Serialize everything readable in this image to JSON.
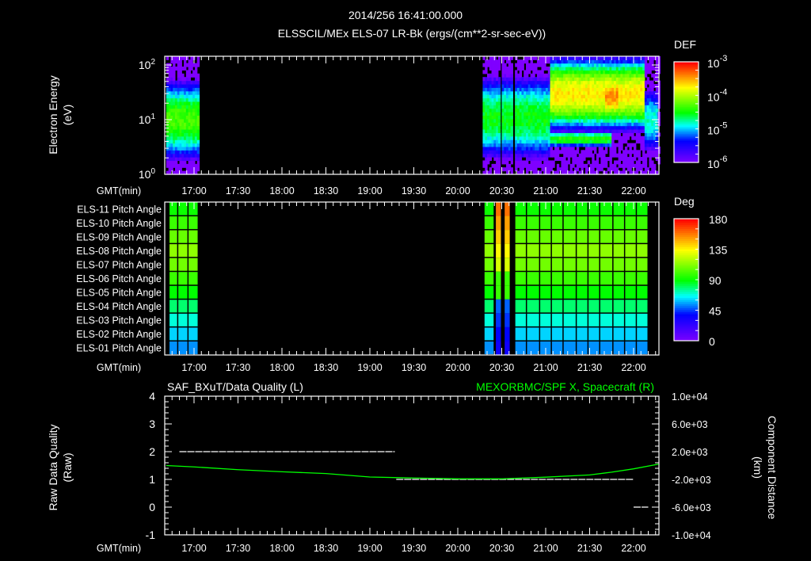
{
  "header": {
    "datetime": "2014/256 16:41:00.000",
    "subtitle": "ELSSCIL/MEx ELS-07 LR-Bk  (ergs/(cm**2-sr-sec-eV))"
  },
  "time_axis": {
    "label": "GMT(min)",
    "start_min": 1001,
    "end_min": 1337,
    "tick_labels": [
      "17:00",
      "17:30",
      "18:00",
      "18:30",
      "19:00",
      "19:30",
      "20:00",
      "20:30",
      "21:00",
      "21:30",
      "22:00"
    ]
  },
  "chart_data": [
    {
      "type": "heatmap",
      "title": "ELSSCIL/MEx ELS-07 LR-Bk  (ergs/(cm**2-sr-sec-eV))",
      "ylabel_line1": "Electron Energy",
      "ylabel_line2": "(eV)",
      "yscale": "log",
      "ylim": [
        1,
        145
      ],
      "y_ticks": [
        {
          "base": "10",
          "exp": "2",
          "value": 100
        },
        {
          "base": "10",
          "exp": "1",
          "value": 10
        },
        {
          "base": "10",
          "exp": "0",
          "value": 1
        }
      ],
      "colorbar": {
        "label": "DEF",
        "scale": "log",
        "range_log10": [
          -6,
          -3
        ],
        "ticks": [
          {
            "base": "10",
            "exp": "-3",
            "value": -3
          },
          {
            "base": "10",
            "exp": "-4",
            "value": -4
          },
          {
            "base": "10",
            "exp": "-5",
            "value": -5
          },
          {
            "base": "10",
            "exp": "-6",
            "value": -6
          }
        ]
      },
      "data_intervals_min": [
        [
          1001,
          1023
        ],
        [
          1217,
          1225
        ],
        [
          1226,
          1229
        ],
        [
          1230,
          1237
        ],
        [
          1239,
          1337
        ]
      ],
      "components": [
        {
          "t": [
            1001,
            1023
          ],
          "center_eV": 10,
          "peak_log10_def": -4.3,
          "width_dec": 0.55
        },
        {
          "t": [
            1217,
            1263
          ],
          "center_eV": 11,
          "peak_log10_def": -4.5,
          "width_dec": 0.6
        },
        {
          "t": [
            1263,
            1328
          ],
          "center_eV": 30,
          "peak_log10_def": -3.7,
          "width_dec": 0.45
        },
        {
          "t": [
            1300,
            1310
          ],
          "center_eV": 27,
          "peak_log10_def": -3.4,
          "width_dec": 0.3
        },
        {
          "t": [
            1263,
            1305
          ],
          "center_eV": 4.5,
          "peak_log10_def": -4.4,
          "width_dec": 0.12
        },
        {
          "t": [
            1328,
            1337
          ],
          "center_eV": 10,
          "peak_log10_def": -4.8,
          "width_dec": 0.5
        }
      ]
    },
    {
      "type": "heatmap",
      "rows": [
        "ELS-11 Pitch Angle",
        "ELS-10 Pitch Angle",
        "ELS-09 Pitch Angle",
        "ELS-08 Pitch Angle",
        "ELS-07 Pitch Angle",
        "ELS-06 Pitch Angle",
        "ELS-05 Pitch Angle",
        "ELS-04 Pitch Angle",
        "ELS-03 Pitch Angle",
        "ELS-02 Pitch Angle",
        "ELS-01 Pitch Angle"
      ],
      "pitch_angle_deg": [
        92,
        100,
        108,
        115,
        110,
        100,
        90,
        80,
        70,
        62,
        55
      ],
      "bins_min": [
        [
          1003,
          1009
        ],
        [
          1009,
          1016
        ],
        [
          1016,
          1023
        ],
        [
          1218,
          1225
        ],
        [
          1239,
          1247
        ],
        [
          1247,
          1256
        ],
        [
          1256,
          1264
        ],
        [
          1264,
          1272
        ],
        [
          1272,
          1281
        ],
        [
          1281,
          1289
        ],
        [
          1289,
          1297
        ],
        [
          1297,
          1306
        ],
        [
          1306,
          1314
        ],
        [
          1314,
          1322
        ],
        [
          1322,
          1330
        ]
      ],
      "spikes_min": [
        [
          1226,
          1230,
          "high"
        ],
        [
          1232,
          1236,
          "high"
        ]
      ],
      "colorbar": {
        "label": "Deg",
        "range": [
          0,
          180
        ],
        "ticks": [
          "180",
          "135",
          "90",
          "45",
          "0"
        ]
      }
    },
    {
      "type": "line",
      "title_left": "SAF_BXuT/Data Quality (L)",
      "title_right": "MEXORBMC/SPF X, Spacecraft (R)",
      "ylabel_left_line1": "Raw Data Quality",
      "ylabel_left_line2": "(Raw)",
      "ylabel_right_line1": "Component Distance",
      "ylabel_right_line2": "(km)",
      "ylim_left": [
        -1,
        4
      ],
      "ylim_right": [
        -10000,
        10000
      ],
      "left_ticks": [
        "4",
        "3",
        "2",
        "1",
        "0",
        "-1"
      ],
      "right_ticks": [
        "1.0e+04",
        "6.0e+03",
        "2.0e+03",
        "-2.0e+03",
        "-6.0e+03",
        "-1.0e+04"
      ],
      "series": [
        {
          "name": "Data Quality",
          "axis": "left",
          "color": "#ffffff",
          "segments": [
            {
              "t": [
                1010,
                1157
              ],
              "value": 2
            },
            {
              "t": [
                1158,
                1320
              ],
              "value": 1
            },
            {
              "t": [
                1335,
                1336
              ],
              "value": 1
            },
            {
              "t": [
                1320,
                1330
              ],
              "value": 0
            }
          ]
        },
        {
          "name": "MEXORBMC/SPF X, Spacecraft",
          "axis": "right",
          "color": "#00ff00",
          "x_min": [
            1001,
            1020,
            1050,
            1080,
            1110,
            1140,
            1170,
            1200,
            1230,
            1260,
            1290,
            1305,
            1320,
            1337
          ],
          "y_km": [
            0,
            -200,
            -600,
            -900,
            -1160,
            -1660,
            -1800,
            -1920,
            -1920,
            -1680,
            -1360,
            -960,
            -480,
            200
          ]
        }
      ]
    }
  ]
}
